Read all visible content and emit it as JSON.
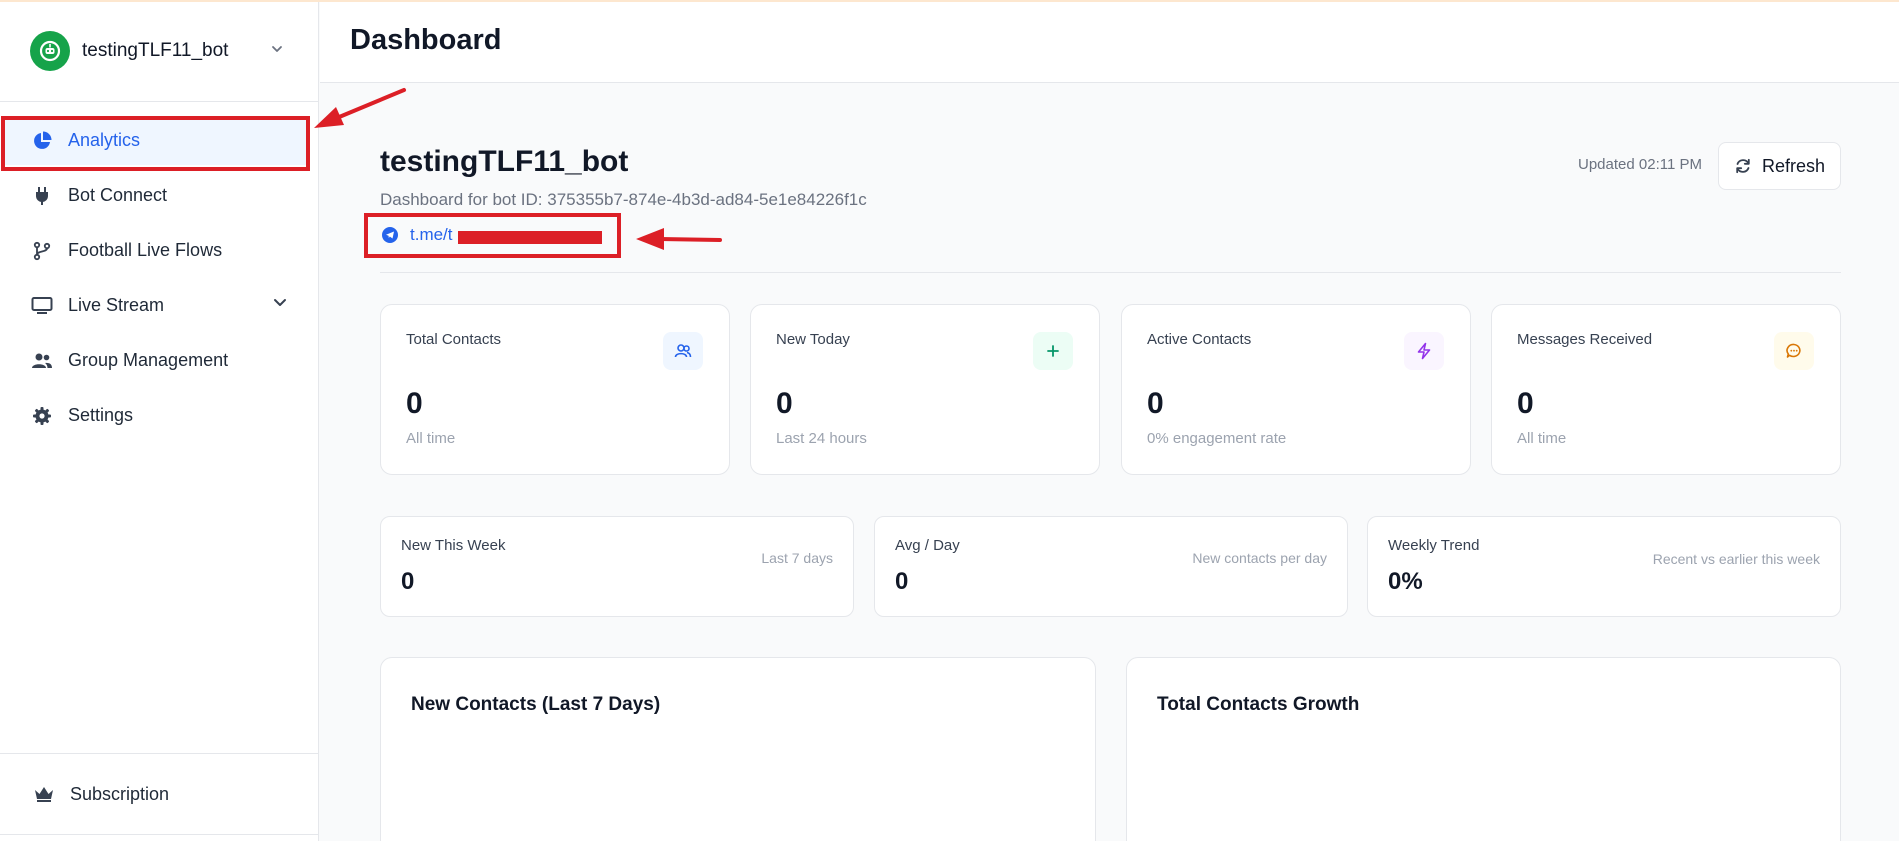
{
  "sidebar": {
    "bot_name": "testingTLF11_bot",
    "items": [
      {
        "label": "Analytics",
        "icon": "pie-chart-icon",
        "active": true
      },
      {
        "label": "Bot Connect",
        "icon": "plug-icon"
      },
      {
        "label": "Football Live Flows",
        "icon": "git-branch-icon"
      },
      {
        "label": "Live Stream",
        "icon": "monitor-icon"
      },
      {
        "label": "Group Management",
        "icon": "users-icon"
      },
      {
        "label": "Settings",
        "icon": "gear-icon"
      }
    ],
    "subscription_label": "Subscription"
  },
  "header": {
    "title": "Dashboard"
  },
  "main": {
    "bot_title": "testingTLF11_bot",
    "bot_id_text": "Dashboard for bot ID: 375355b7-874e-4b3d-ad84-5e1e84226f1c",
    "bot_link": "t.me/t",
    "updated": "Updated 02:11 PM",
    "refresh_label": "Refresh"
  },
  "stats": [
    {
      "label": "Total Contacts",
      "value": "0",
      "sub": "All time",
      "icon": "users-icon",
      "badge_bg": "#eff6ff",
      "icon_color": "#2563eb"
    },
    {
      "label": "New Today",
      "value": "0",
      "sub": "Last 24 hours",
      "icon": "plus-icon",
      "badge_bg": "#ecfdf5",
      "icon_color": "#059669"
    },
    {
      "label": "Active Contacts",
      "value": "0",
      "sub": "0% engagement rate",
      "icon": "bolt-icon",
      "badge_bg": "#faf5ff",
      "icon_color": "#9333ea"
    },
    {
      "label": "Messages Received",
      "value": "0",
      "sub": "All time",
      "icon": "message-icon",
      "badge_bg": "#fffbeb",
      "icon_color": "#d97706"
    }
  ],
  "mini_stats": [
    {
      "label": "New This Week",
      "value": "0",
      "note": "Last 7 days"
    },
    {
      "label": "Avg / Day",
      "value": "0",
      "note": "New contacts per day"
    },
    {
      "label": "Weekly Trend",
      "value": "0%",
      "note": "Recent vs earlier this week"
    }
  ],
  "panels": [
    {
      "title": "New Contacts (Last 7 Days)"
    },
    {
      "title": "Total Contacts Growth"
    }
  ],
  "colors": {
    "accent": "#2563eb",
    "annotation": "#dc1f26",
    "bot_avatar": "#16a34a"
  }
}
